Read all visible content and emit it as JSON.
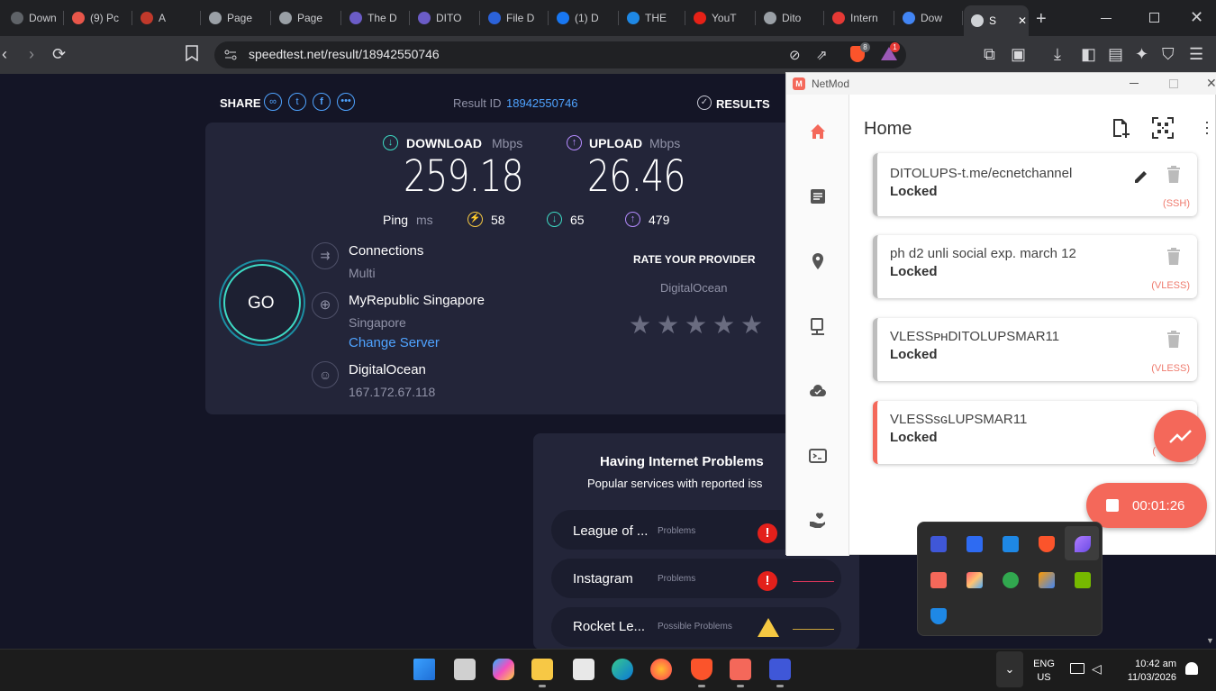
{
  "browser": {
    "tabs": [
      {
        "label": "Down",
        "icon": "generic-icon",
        "color": "#5f6368"
      },
      {
        "label": "(9) Pc",
        "icon": "puzzle-icon",
        "color": "#e8564a"
      },
      {
        "label": "A",
        "icon": "shield-icon",
        "color": "#c0392b"
      },
      {
        "label": "Page",
        "icon": "globe-icon",
        "color": "#9aa0a6"
      },
      {
        "label": "Page",
        "icon": "globe-icon",
        "color": "#9aa0a6"
      },
      {
        "label": "The D",
        "icon": "shield-icon",
        "color": "#6b5cc7"
      },
      {
        "label": "DITO",
        "icon": "shield-icon",
        "color": "#6b5cc7"
      },
      {
        "label": "File D",
        "icon": "dl-icon",
        "color": "#2b62d9"
      },
      {
        "label": "(1) D",
        "icon": "facebook-icon",
        "color": "#1877f2"
      },
      {
        "label": "THE",
        "icon": "circle-icon",
        "color": "#1e88e5"
      },
      {
        "label": "YouT",
        "icon": "youtube-icon",
        "color": "#e62117"
      },
      {
        "label": "Dito",
        "icon": "globe-icon",
        "color": "#9aa0a6"
      },
      {
        "label": "Intern",
        "icon": "gauge-icon",
        "color": "#e53935"
      },
      {
        "label": "Dow",
        "icon": "download-icon",
        "color": "#4285f4"
      },
      {
        "label": "S",
        "icon": "speedtest-icon",
        "color": "#cfd2d6"
      }
    ],
    "url": "speedtest.net/result/18942550746",
    "brave_badge": "8",
    "alert_badge": "1"
  },
  "speedtest": {
    "share_label": "SHARE",
    "result_id_label": "Result ID",
    "result_id": "18942550746",
    "results_label": "RESULTS",
    "download_label": "DOWNLOAD",
    "upload_label": "UPLOAD",
    "unit": "Mbps",
    "download_value": "259.18",
    "upload_value": "26.46",
    "ping_label": "Ping",
    "ping_unit": "ms",
    "ping_idle": "58",
    "ping_download": "65",
    "ping_upload": "479",
    "go_label": "GO",
    "connections_label": "Connections",
    "connections_value": "Multi",
    "server_name": "MyRepublic Singapore",
    "server_location": "Singapore",
    "change_server": "Change Server",
    "host_name": "DigitalOcean",
    "host_ip": "167.172.67.118",
    "rate_title": "RATE YOUR PROVIDER",
    "rate_provider": "DigitalOcean",
    "problems_title": "Having Internet Problems",
    "problems_sub": "Popular services with reported iss",
    "problems": [
      {
        "name": "League of ...",
        "status": "Problems",
        "level": "error"
      },
      {
        "name": "Instagram",
        "status": "Problems",
        "level": "error"
      },
      {
        "name": "Rocket Le...",
        "status": "Possible Problems",
        "level": "warning"
      }
    ],
    "accent_download": "#3ddbc5",
    "accent_upload": "#b58bff",
    "accent_link": "#4fa3ff"
  },
  "netmod": {
    "window_title": "NetMod",
    "page_title": "Home",
    "configs": [
      {
        "name": "DITOLUPS-t.me/ecnetchannel",
        "status": "Locked",
        "type": "(SSH)",
        "active": false
      },
      {
        "name": "ph d2 unli social exp. march 12",
        "status": "Locked",
        "type": "(VLESS)",
        "active": false
      },
      {
        "name": "VLESSᴘʜDITOLUPSMAR11",
        "status": "Locked",
        "type": "(VLESS)",
        "active": false
      },
      {
        "name": "VLESSsɢLUPSMAR11",
        "status": "Locked",
        "type": "(",
        "active": true
      }
    ],
    "timer": "00:01:26",
    "accent": "#f4685a"
  },
  "taskbar": {
    "lang": "ENG",
    "region": "US",
    "time": "10:42 am",
    "date": "11/03/2026"
  }
}
